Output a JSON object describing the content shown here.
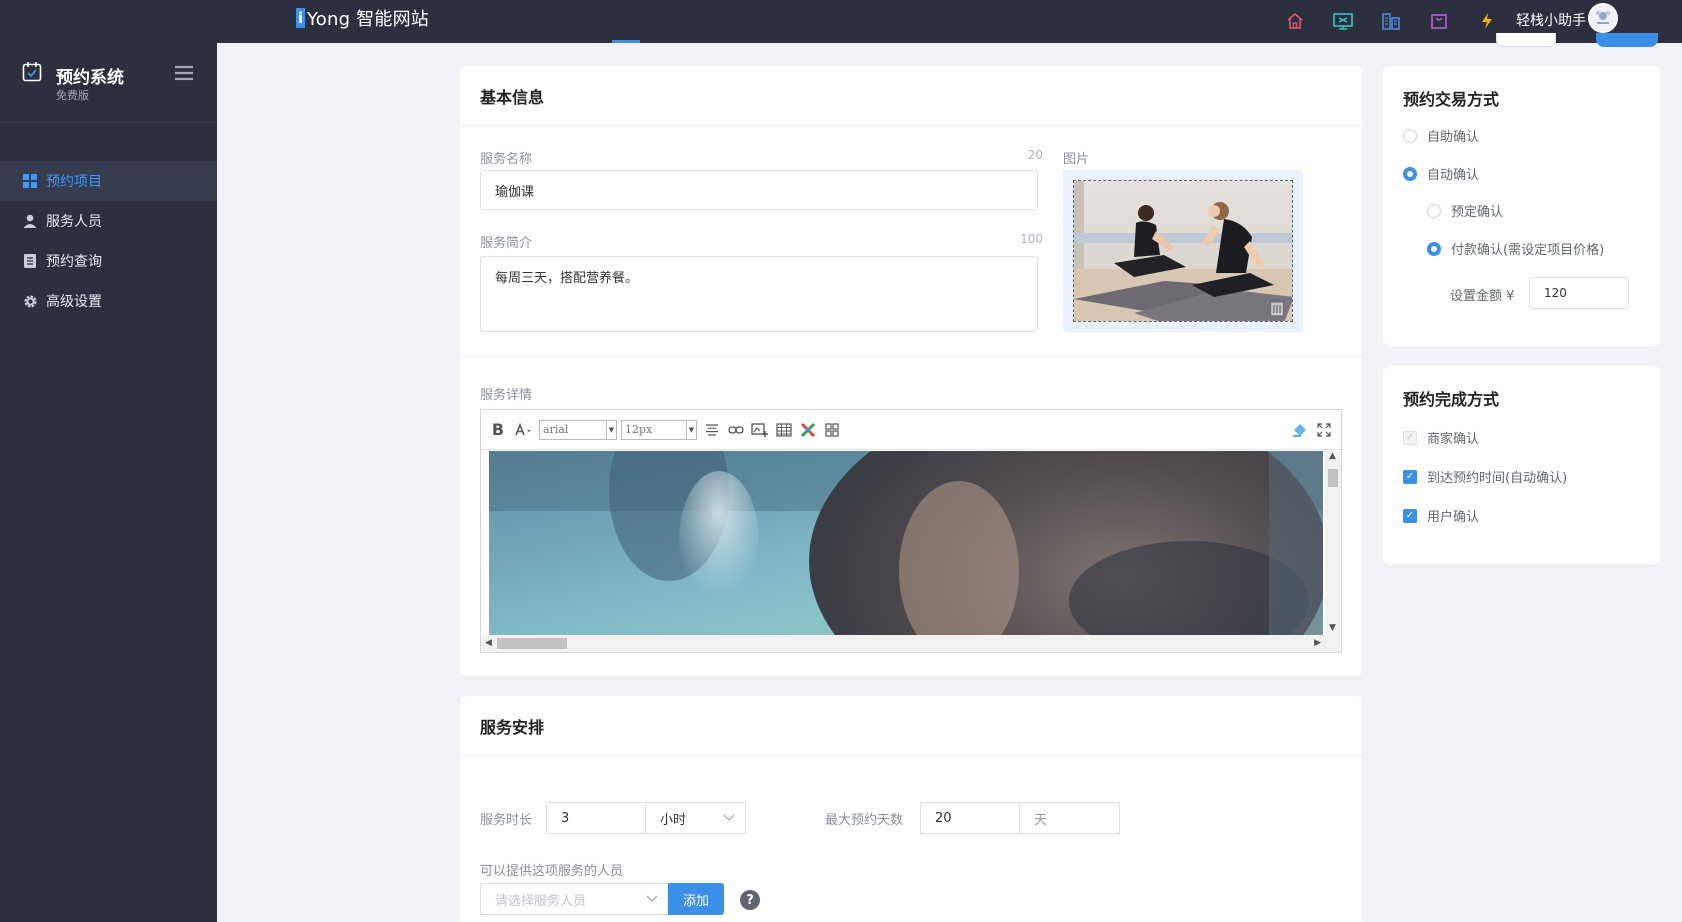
{
  "topbar": {
    "brand_i": "i",
    "brand_text": "Yong 智能网站",
    "helper_name": "轻栈小助手",
    "icons": [
      "home-icon",
      "monitor-icon",
      "building-icon",
      "bag-icon",
      "lightning-icon"
    ]
  },
  "sidebar": {
    "title": "预约系统",
    "subtitle": "免费版",
    "items": [
      {
        "label": "预约项目",
        "icon": "grid-icon",
        "active": true
      },
      {
        "label": "服务人员",
        "icon": "user-icon",
        "active": false
      },
      {
        "label": "预约查询",
        "icon": "list-icon",
        "active": false
      },
      {
        "label": "高级设置",
        "icon": "gear-icon",
        "active": false
      }
    ]
  },
  "basic": {
    "header": "基本信息",
    "name_label": "服务名称",
    "name_count": "20",
    "name_value": "瑜伽课",
    "intro_label": "服务简介",
    "intro_count": "100",
    "intro_value": "每周三天，搭配营养餐。",
    "image_label": "图片",
    "detail_label": "服务详情",
    "font_family": "arial",
    "font_size": "12px"
  },
  "arrange": {
    "header": "服务安排",
    "duration_label": "服务时长",
    "duration_value": "3",
    "duration_unit": "小时",
    "max_days_label": "最大预约天数",
    "max_days_value": "20",
    "max_days_unit": "天",
    "staff_label": "可以提供这项服务的人员",
    "staff_placeholder": "请选择服务人员",
    "add_button": "添加",
    "help": "?"
  },
  "trade": {
    "title": "预约交易方式",
    "opt_manual": "自助确认",
    "opt_auto": "自动确认",
    "opt_reserve": "预定确认",
    "opt_pay": "付款确认(需设定项目价格)",
    "amount_label": "设置金额 ¥",
    "amount_value": "120"
  },
  "complete": {
    "title": "预约完成方式",
    "opt_merchant": "商家确认",
    "opt_arrive": "到达预约时间(自动确认)",
    "opt_user": "用户确认"
  },
  "colors": {
    "accent": "#3b8fe6",
    "dark": "#2b2f3e"
  }
}
